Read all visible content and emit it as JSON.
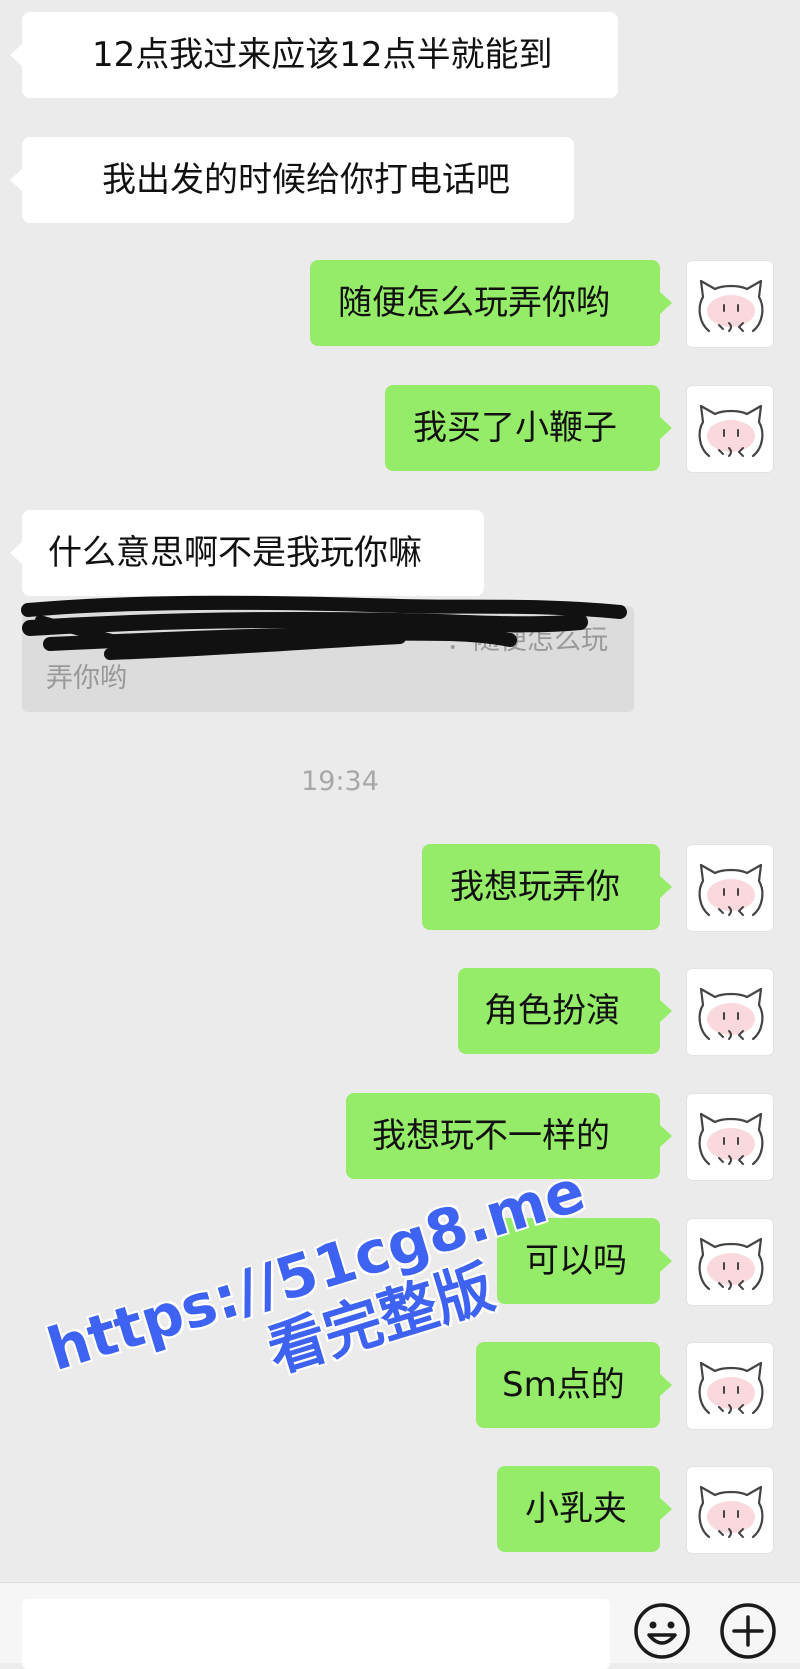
{
  "messages": [
    {
      "side": "in",
      "text": "12点我过来应该12点半就能到"
    },
    {
      "side": "in",
      "text": "我出发的时候给你打电话吧"
    },
    {
      "side": "out",
      "text": "随便怎么玩弄你哟"
    },
    {
      "side": "out",
      "text": "我买了小鞭子"
    },
    {
      "side": "in",
      "text": "什么意思啊不是我玩你嘛"
    },
    {
      "side": "out",
      "text": "我想玩弄你"
    },
    {
      "side": "out",
      "text": "角色扮演"
    },
    {
      "side": "out",
      "text": "我想玩不一样的"
    },
    {
      "side": "out",
      "text": "可以吗"
    },
    {
      "side": "out",
      "text": "Sm点的"
    },
    {
      "side": "out",
      "text": "小乳夹"
    }
  ],
  "quote": {
    "text": "：随便怎么玩弄你哟"
  },
  "timestamp": "19:34",
  "watermark": {
    "url": "https://51cg8.me",
    "sub": "看完整版"
  },
  "input_bar": {
    "icons": [
      "emoji-icon",
      "plus-icon"
    ]
  },
  "colors": {
    "outgoing_bubble": "#95ec69",
    "incoming_bubble": "#ffffff",
    "background": "#ebebeb",
    "watermark": "#3e63f2"
  }
}
